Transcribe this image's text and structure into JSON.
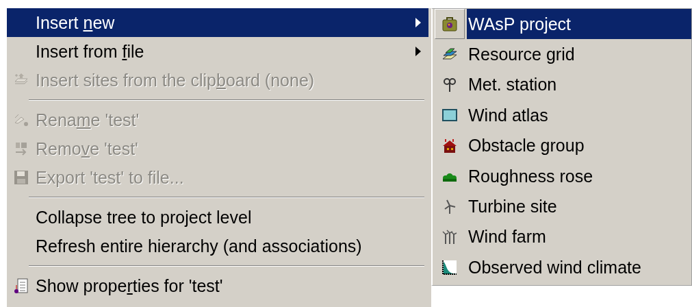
{
  "context_menu": {
    "items": [
      {
        "kind": "item",
        "label_parts": [
          "Insert ",
          "n",
          "ew"
        ],
        "selected": true,
        "disabled": false,
        "submenu": true
      },
      {
        "kind": "item",
        "label_parts": [
          "Insert from ",
          "f",
          "ile"
        ],
        "selected": false,
        "disabled": false,
        "submenu": true
      },
      {
        "kind": "item",
        "label_parts": [
          "Insert sites from the clip",
          "b",
          "oard (none)"
        ],
        "selected": false,
        "disabled": true,
        "submenu": false
      },
      {
        "kind": "separator"
      },
      {
        "kind": "item",
        "label_parts": [
          "Rena",
          "m",
          "e 'test'"
        ],
        "selected": false,
        "disabled": true,
        "submenu": false
      },
      {
        "kind": "item",
        "label_parts": [
          "Remo",
          "v",
          "e 'test'"
        ],
        "selected": false,
        "disabled": true,
        "submenu": false
      },
      {
        "kind": "item",
        "label_parts": [
          "Export 'test' to file..."
        ],
        "selected": false,
        "disabled": true,
        "submenu": false
      },
      {
        "kind": "separator"
      },
      {
        "kind": "item",
        "label_parts": [
          "Collapse tree to project level"
        ],
        "selected": false,
        "disabled": false,
        "submenu": false
      },
      {
        "kind": "item",
        "label_parts": [
          "Refresh entire hierarchy (and associations)"
        ],
        "selected": false,
        "disabled": false,
        "submenu": false
      },
      {
        "kind": "separator"
      },
      {
        "kind": "item",
        "label_parts": [
          "Show prope",
          "r",
          "ties for 'test'"
        ],
        "selected": false,
        "disabled": false,
        "submenu": false
      }
    ]
  },
  "submenu": {
    "items": [
      {
        "label": "WAsP project",
        "selected": true
      },
      {
        "label": "Resource grid",
        "selected": false
      },
      {
        "label": "Met. station",
        "selected": false
      },
      {
        "label": "Wind atlas",
        "selected": false
      },
      {
        "label": "Obstacle group",
        "selected": false
      },
      {
        "label": "Roughness rose",
        "selected": false
      },
      {
        "label": "Turbine site",
        "selected": false
      },
      {
        "label": "Wind farm",
        "selected": false
      },
      {
        "label": "Observed wind climate",
        "selected": false
      }
    ]
  }
}
